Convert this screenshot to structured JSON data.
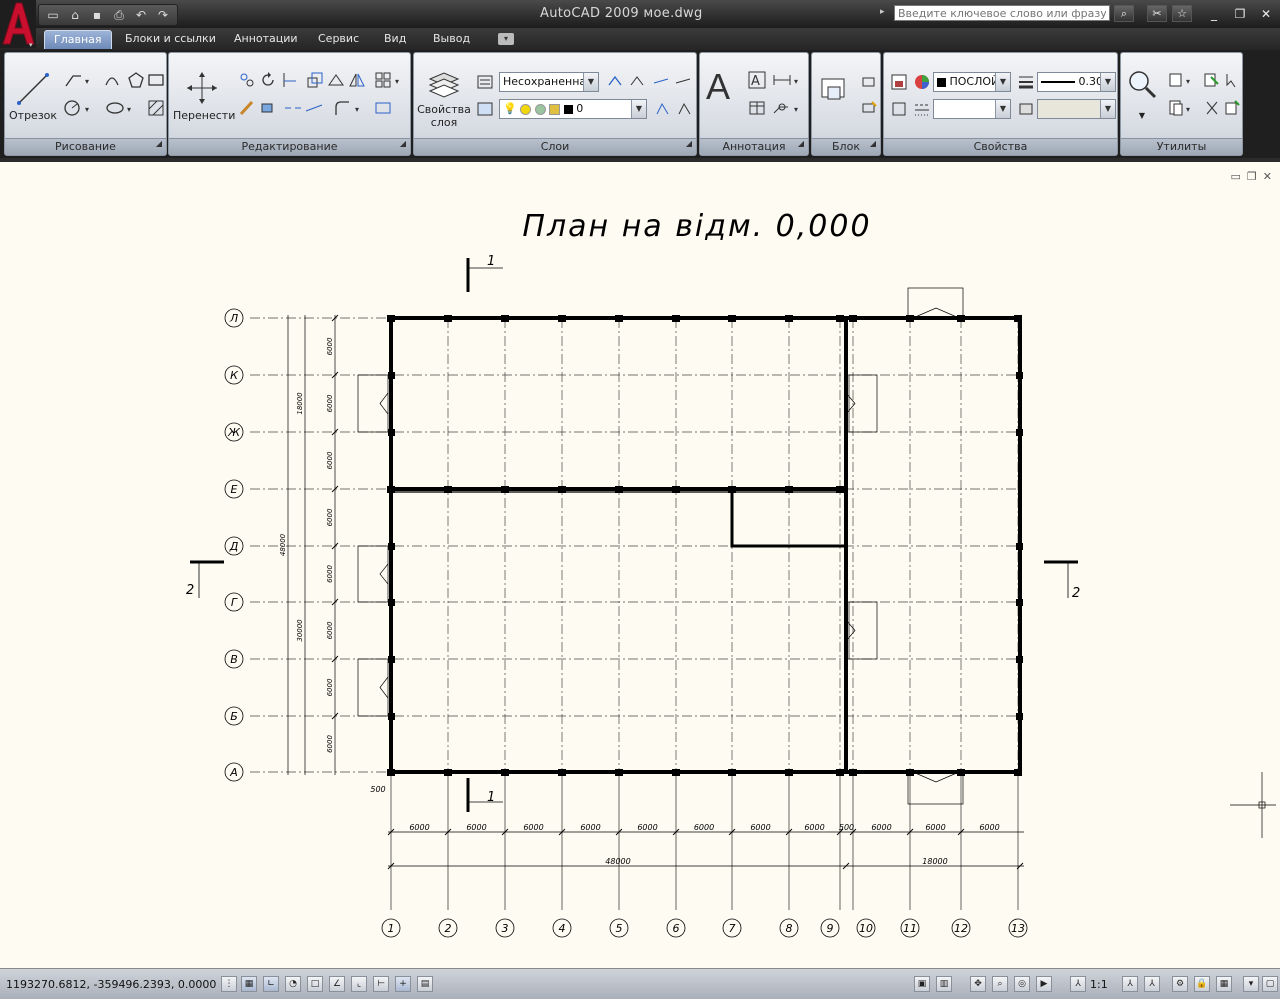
{
  "window": {
    "title": "AutoCAD 2009 мое.dwg",
    "search_placeholder": "Введите ключевое слово или фразу",
    "logo_letter": "A"
  },
  "tabs": [
    {
      "label": "Главная",
      "active": true
    },
    {
      "label": "Блоки и ссылки"
    },
    {
      "label": "Аннотации"
    },
    {
      "label": "Сервис"
    },
    {
      "label": "Вид"
    },
    {
      "label": "Вывод"
    }
  ],
  "ribbon": {
    "draw": {
      "title": "Рисование",
      "line_label": "Отрезок"
    },
    "modify": {
      "title": "Редактирование",
      "move_label": "Перенести"
    },
    "layers": {
      "title": "Слои",
      "props_label": "Свойства слоя",
      "layer_state": "Несохраненная",
      "current_layer": "0"
    },
    "annotation": {
      "title": "Аннотация",
      "text_glyph": "A"
    },
    "block": {
      "title": "Блок"
    },
    "properties": {
      "title": "Свойства",
      "color": "ПОСЛОЙ",
      "lineweight": "0.30"
    },
    "utilities": {
      "title": "Утилиты"
    }
  },
  "drawing": {
    "title": "План на відм. 0,000",
    "section_marks": {
      "top": "1",
      "bottom": "1",
      "left": "2",
      "right": "2"
    },
    "row_axes": [
      "Л",
      "К",
      "Ж",
      "Е",
      "Д",
      "Г",
      "В",
      "Б",
      "А"
    ],
    "column_axes": [
      "1",
      "2",
      "3",
      "4",
      "5",
      "6",
      "7",
      "8",
      "9",
      "10",
      "11",
      "12",
      "13"
    ],
    "col_dims": [
      "6000",
      "6000",
      "6000",
      "6000",
      "6000",
      "6000",
      "6000",
      "6000",
      "500",
      "6000",
      "6000",
      "6000"
    ],
    "overall_dims": {
      "left": "48000",
      "right": "18000"
    },
    "row_dims": [
      "6000",
      "6000",
      "6000",
      "6000",
      "6000",
      "6000",
      "6000",
      "6000"
    ],
    "left_group_dims": {
      "top": "18000",
      "total": "48000",
      "bottom": "30000"
    },
    "offset_dim": "500"
  },
  "status": {
    "coords": "1193270.6812, -359496.2393, 0.0000",
    "scale": "1:1"
  },
  "colors": {
    "canvas": "#fefcf2",
    "accent_tab": "#6d89b8",
    "logo_red": "#c8102e"
  }
}
